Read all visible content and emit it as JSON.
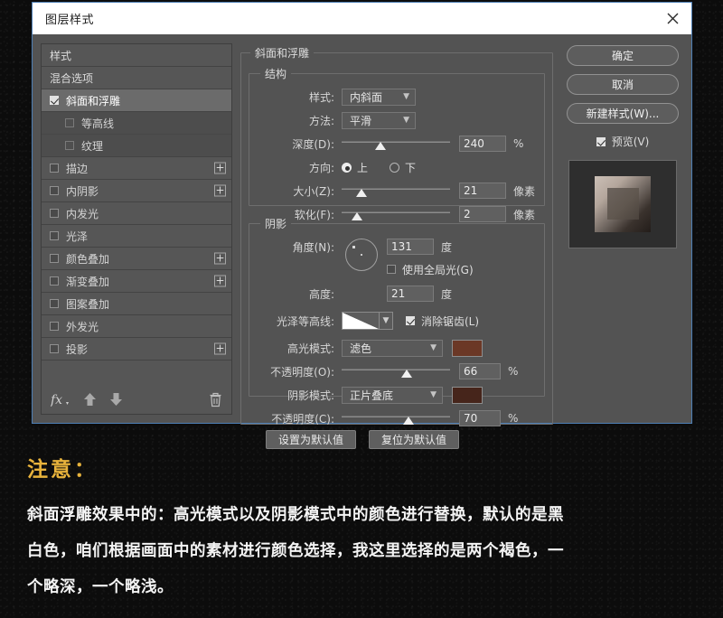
{
  "dialog": {
    "title": "图层样式",
    "close_icon": "close-icon"
  },
  "sidebar": {
    "items": [
      {
        "label": "样式",
        "type": "header",
        "checkbox": "none",
        "plus": false
      },
      {
        "label": "混合选项",
        "type": "header",
        "checkbox": "none",
        "plus": false
      },
      {
        "label": "斜面和浮雕",
        "type": "item",
        "checkbox": "checked",
        "plus": false,
        "selected": true
      },
      {
        "label": "等高线",
        "type": "sub",
        "checkbox": "unchecked",
        "plus": false
      },
      {
        "label": "纹理",
        "type": "sub",
        "checkbox": "unchecked",
        "plus": false
      },
      {
        "label": "描边",
        "type": "item",
        "checkbox": "unchecked",
        "plus": true
      },
      {
        "label": "内阴影",
        "type": "item",
        "checkbox": "unchecked",
        "plus": true
      },
      {
        "label": "内发光",
        "type": "item",
        "checkbox": "unchecked",
        "plus": false
      },
      {
        "label": "光泽",
        "type": "item",
        "checkbox": "unchecked",
        "plus": false
      },
      {
        "label": "颜色叠加",
        "type": "item",
        "checkbox": "unchecked",
        "plus": true
      },
      {
        "label": "渐变叠加",
        "type": "item",
        "checkbox": "unchecked",
        "plus": true
      },
      {
        "label": "图案叠加",
        "type": "item",
        "checkbox": "unchecked",
        "plus": false
      },
      {
        "label": "外发光",
        "type": "item",
        "checkbox": "unchecked",
        "plus": false
      },
      {
        "label": "投影",
        "type": "item",
        "checkbox": "unchecked",
        "plus": true
      }
    ],
    "toolbar": {
      "fx_label": "fx",
      "up_icon": "arrow-up-icon",
      "down_icon": "arrow-down-icon",
      "delete_icon": "trash-icon"
    }
  },
  "main": {
    "group_title": "斜面和浮雕",
    "structure": {
      "legend": "结构",
      "style_label": "样式:",
      "style_value": "内斜面",
      "method_label": "方法:",
      "method_value": "平滑",
      "depth_label": "深度(D):",
      "depth_value": "240",
      "depth_unit": "%",
      "depth_percent": 36,
      "direction_label": "方向:",
      "direction_up": "上",
      "direction_down": "下",
      "direction_selected": "上",
      "size_label": "大小(Z):",
      "size_value": "21",
      "size_unit": "像素",
      "size_percent": 18,
      "soften_label": "软化(F):",
      "soften_value": "2",
      "soften_unit": "像素",
      "soften_percent": 14
    },
    "shading": {
      "legend": "阴影",
      "angle_label": "角度(N):",
      "angle_value": "131",
      "angle_unit": "度",
      "global_light_label": "使用全局光(G)",
      "global_light_checked": false,
      "altitude_label": "高度:",
      "altitude_value": "21",
      "altitude_unit": "度",
      "contour_label": "光泽等高线:",
      "antialias_label": "消除锯齿(L)",
      "antialias_checked": true,
      "highlight_mode_label": "高光模式:",
      "highlight_mode_value": "滤色",
      "highlight_color": "#6B3826",
      "highlight_opacity_label": "不透明度(O):",
      "highlight_opacity_value": "66",
      "highlight_opacity_unit": "%",
      "highlight_opacity_percent": 60,
      "shadow_mode_label": "阴影模式:",
      "shadow_mode_value": "正片叠底",
      "shadow_color": "#46251B",
      "shadow_opacity_label": "不透明度(C):",
      "shadow_opacity_value": "70",
      "shadow_opacity_unit": "%",
      "shadow_opacity_percent": 62
    },
    "set_default_label": "设置为默认值",
    "reset_default_label": "复位为默认值"
  },
  "right": {
    "ok_label": "确定",
    "cancel_label": "取消",
    "new_style_label": "新建样式(W)...",
    "preview_label": "预览(V)",
    "preview_checked": true
  },
  "caption": {
    "title": "注意：",
    "line1": "斜面浮雕效果中的：高光模式以及阴影模式中的颜色进行替换，默认的是黑",
    "line2": "白色，咱们根据画面中的素材进行颜色选择，我这里选择的是两个褐色，一",
    "line3": "个略深，一个略浅。"
  }
}
